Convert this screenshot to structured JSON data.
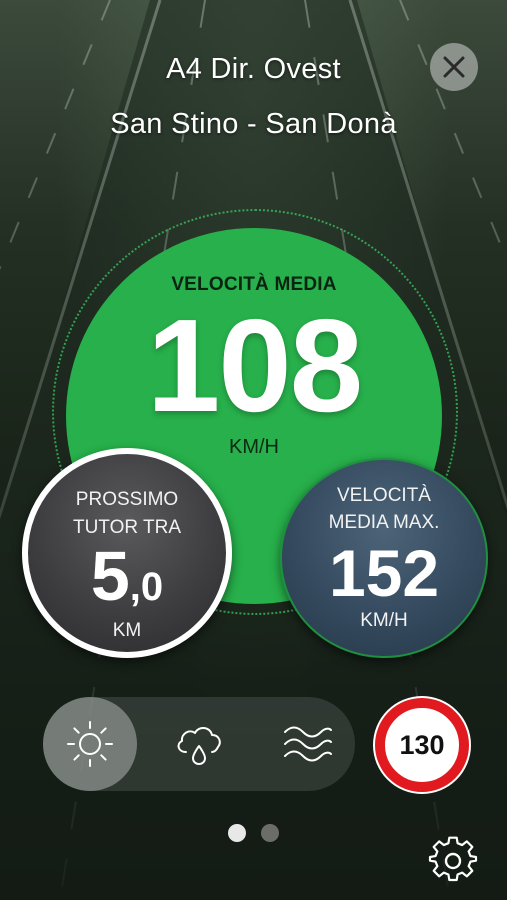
{
  "header": {
    "road": "A4 Dir. Ovest",
    "segment": "San Stino - San Donà"
  },
  "average_speed": {
    "label": "VELOCITÀ MEDIA",
    "value": "108",
    "unit": "KM/H",
    "status_color": "#27b04b"
  },
  "next_tutor": {
    "label_line1": "PROSSIMO",
    "label_line2": "TUTOR TRA",
    "value_int": "5",
    "value_dec": ",0",
    "unit": "KM"
  },
  "max_average_speed": {
    "label_line1": "VELOCITÀ",
    "label_line2": "MEDIA MAX.",
    "value": "152",
    "unit": "KM/H"
  },
  "weather_conditions": {
    "options": [
      {
        "icon": "sun-icon",
        "selected": true
      },
      {
        "icon": "rain-cloud-icon",
        "selected": false
      },
      {
        "icon": "fog-icon",
        "selected": false
      }
    ]
  },
  "speed_limit": {
    "value": "130",
    "border_color": "#e01a1f"
  },
  "pagination": {
    "total": 2,
    "active": 1
  }
}
